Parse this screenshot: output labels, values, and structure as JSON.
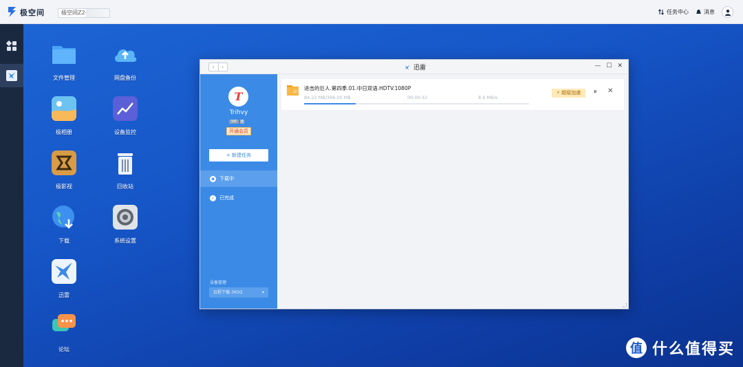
{
  "topbar": {
    "brand": "极空间",
    "device_name": "极空间Z2-",
    "task_center": "任务中心",
    "messages": "消息"
  },
  "desktop": {
    "icons": [
      {
        "label": "文件管理"
      },
      {
        "label": "网盘备份"
      },
      {
        "label": "极相册"
      },
      {
        "label": "设备监控"
      },
      {
        "label": "极影视"
      },
      {
        "label": "回收站"
      },
      {
        "label": "下载"
      },
      {
        "label": "系统设置"
      },
      {
        "label": "迅雷"
      },
      {
        "label": "论坛"
      }
    ]
  },
  "window": {
    "title": "迅雷",
    "user": {
      "initial": "T",
      "name": "Trihvy",
      "vip_badge": "VIP",
      "level_badge": "0",
      "open_member": "开通会员"
    },
    "new_task": "+ 新建任务",
    "menu": {
      "downloading": "下载中",
      "completed": "已完成"
    },
    "device_mgmt_label": "设备管理",
    "device_select": "远程下载-3KSQ",
    "task": {
      "name": "进击的巨人.第四季.01.中日双语.HDTV.1080P",
      "size": "84.22 MB/366.00 MB",
      "time": "00:00:32",
      "speed": "8.6 MB/s",
      "progress": 0.23,
      "speedup": "超级加速"
    }
  },
  "watermark": {
    "glyph": "值",
    "text": "什么值得买"
  }
}
